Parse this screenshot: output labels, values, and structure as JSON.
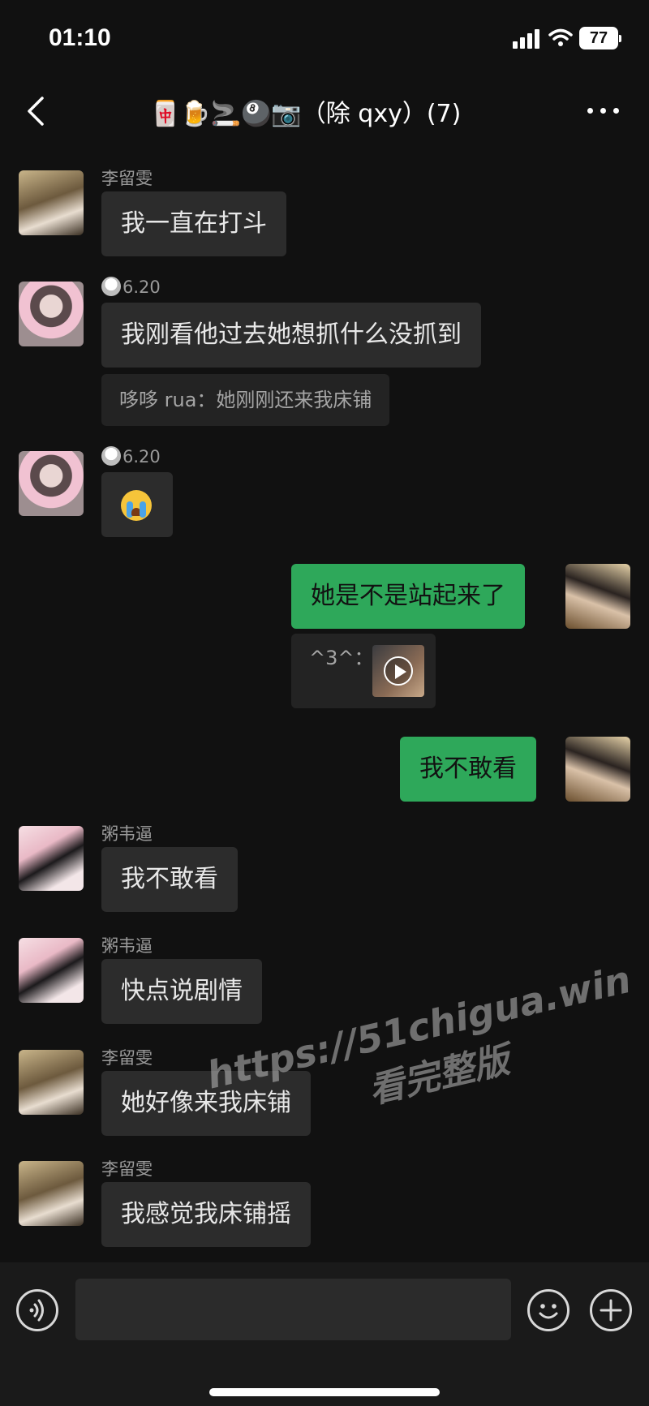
{
  "status_bar": {
    "time": "01:10",
    "battery": "77"
  },
  "header": {
    "title": "🀄🍺🚬🎱📷（除 qxy）(7)"
  },
  "messages": [
    {
      "sender": "李留雯",
      "text": "我一直在打斗"
    },
    {
      "sender": "6.20",
      "text": "我刚看他过去她想抓什么没抓到",
      "quote": "哆哆 rua：她刚刚还来我床铺"
    },
    {
      "sender": "6.20",
      "text": "😭"
    },
    {
      "self": true,
      "text": "她是不是站起来了",
      "quote": "^3^："
    },
    {
      "self": true,
      "text": "我不敢看"
    },
    {
      "sender": "粥韦逼",
      "text": "我不敢看"
    },
    {
      "sender": "粥韦逼",
      "text": "快点说剧情"
    },
    {
      "sender": "李留雯",
      "text": "她好像来我床铺"
    },
    {
      "sender": "李留雯",
      "text": "我感觉我床铺摇"
    }
  ],
  "watermark": {
    "url": "https://51chigua.win",
    "sub": "看完整版"
  },
  "input": {
    "value": ""
  },
  "icons": {
    "back": "back-arrow-icon",
    "more": "more-dots-icon",
    "voice": "voice-icon",
    "emoji": "emoji-icon",
    "plus": "plus-icon",
    "play": "play-icon"
  }
}
